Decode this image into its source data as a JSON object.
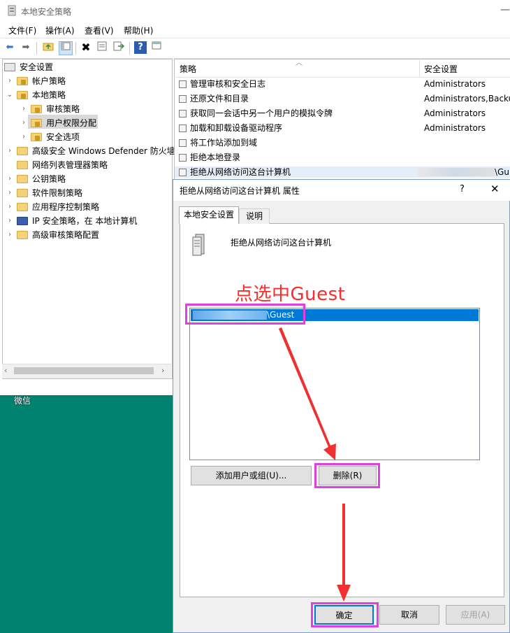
{
  "window": {
    "title": "本地安全策略",
    "menus": [
      "文件(F)",
      "操作(A)",
      "查看(V)",
      "帮助(H)"
    ]
  },
  "toolbar": {
    "icons": [
      "back-arrow-icon",
      "forward-arrow-icon",
      "up-folder-icon",
      "show-tree-icon",
      "delete-icon",
      "properties-icon",
      "export-icon",
      "help-icon",
      "console-icon"
    ]
  },
  "tree": {
    "items": [
      {
        "label": "安全设置",
        "level": 0,
        "arrow": "",
        "icon": "security-settings-icon"
      },
      {
        "label": "帐户策略",
        "level": 1,
        "arrow": "›",
        "icon": "folder-lock-icon"
      },
      {
        "label": "本地策略",
        "level": 1,
        "arrow": "⌄",
        "icon": "folder-lock-icon"
      },
      {
        "label": "审核策略",
        "level": 2,
        "arrow": "›",
        "icon": "folder-lock-icon"
      },
      {
        "label": "用户权限分配",
        "level": 2,
        "arrow": "›",
        "icon": "folder-lock-icon",
        "selected": true
      },
      {
        "label": "安全选项",
        "level": 2,
        "arrow": "›",
        "icon": "folder-lock-icon"
      },
      {
        "label": "高级安全 Windows Defender 防火墙",
        "level": 1,
        "arrow": "›",
        "icon": "folder-icon"
      },
      {
        "label": "网络列表管理器策略",
        "level": 1,
        "arrow": "",
        "icon": "folder-icon"
      },
      {
        "label": "公钥策略",
        "level": 1,
        "arrow": "›",
        "icon": "folder-icon"
      },
      {
        "label": "软件限制策略",
        "level": 1,
        "arrow": "›",
        "icon": "folder-icon"
      },
      {
        "label": "应用程序控制策略",
        "level": 1,
        "arrow": "›",
        "icon": "folder-icon"
      },
      {
        "label": "IP 安全策略，在 本地计算机",
        "level": 1,
        "arrow": "›",
        "icon": "ip-security-icon"
      },
      {
        "label": "高级审核策略配置",
        "level": 1,
        "arrow": "›",
        "icon": "folder-icon"
      }
    ]
  },
  "policy_list": {
    "col_policy": "策略",
    "col_setting": "安全设置",
    "rows": [
      {
        "name": "管理审核和安全日志",
        "setting": "Administrators"
      },
      {
        "name": "还原文件和目录",
        "setting": "Administrators,Backu"
      },
      {
        "name": "获取同一会话中另一个用户的模拟令牌",
        "setting": "Administrators"
      },
      {
        "name": "加载和卸载设备驱动程序",
        "setting": "Administrators"
      },
      {
        "name": "将工作站添加到域",
        "setting": ""
      },
      {
        "name": "拒绝本地登录",
        "setting": ""
      },
      {
        "name": "拒绝从网络访问这台计算机",
        "setting": "\\Gu"
      }
    ]
  },
  "dialog": {
    "title": "拒绝从网络访问这台计算机 属性",
    "help": "?",
    "close": "✕",
    "tab_local": "本地安全设置",
    "tab_explain": "说明",
    "policy_title": "拒绝从网络访问这台计算机",
    "account_item": "\\Guest",
    "btn_add": "添加用户或组(U)...",
    "btn_remove": "删除(R)",
    "btn_ok": "确定",
    "btn_cancel": "取消",
    "btn_apply": "应用(A)"
  },
  "annotation": {
    "text": "点选中Guest",
    "color": "#ff2a2a",
    "box_color": "#e040e0"
  },
  "desktop": {
    "icon_label": "微信",
    "background": "#008270"
  }
}
